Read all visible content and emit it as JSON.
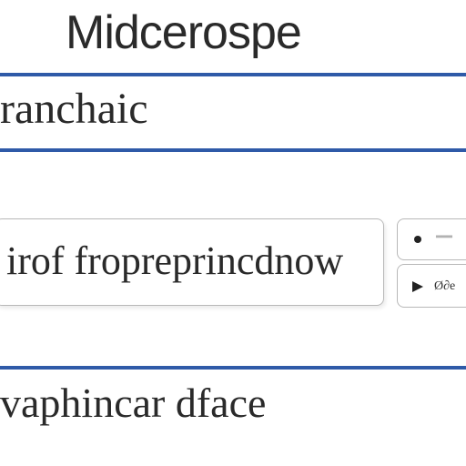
{
  "header": {
    "title": "Midcerospe"
  },
  "section": {
    "label": "ranchaic"
  },
  "field": {
    "value": "irof fropreprincdnow"
  },
  "side_buttons": [
    {
      "label": "═══"
    },
    {
      "label": "Ø∂e"
    }
  ],
  "footer": {
    "text": "vaphincar dface"
  },
  "colors": {
    "accent": "#2f5aa8",
    "border": "#b8b8b8"
  },
  "icons": [
    "bullet-dot-icon",
    "play-icon"
  ]
}
